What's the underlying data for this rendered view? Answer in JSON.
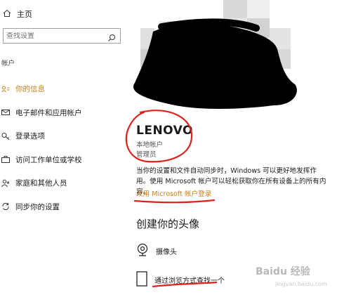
{
  "sidebar": {
    "home_label": "主页",
    "search_placeholder": "查找设置",
    "section_label": "帐户",
    "items": [
      {
        "label": "你的信息",
        "icon": "user-list-icon"
      },
      {
        "label": "电子邮件和应用帐户",
        "icon": "mail-icon"
      },
      {
        "label": "登录选项",
        "icon": "key-icon"
      },
      {
        "label": "访问工作单位或学校",
        "icon": "briefcase-icon"
      },
      {
        "label": "家庭和其他人员",
        "icon": "person-add-icon"
      },
      {
        "label": "同步你的设置",
        "icon": "sync-icon"
      }
    ]
  },
  "profile": {
    "name": "LENOVO",
    "account_type": "本地帐户",
    "role": "管理员"
  },
  "sync": {
    "text": "当你的设置和文件自动同步时，Windows 可以更好地发挥作用。使用 Microsoft 帐户可以轻松获取你在所有设备上的所有内容。",
    "link": "改用 Microsoft 帐户登录"
  },
  "picture": {
    "heading": "创建你的头像",
    "options": [
      {
        "label": "摄像头",
        "icon": "camera-icon"
      },
      {
        "label": "通过浏览方式查找一个",
        "icon": "browse-icon"
      }
    ]
  },
  "watermark": {
    "text": "Baidu 经验",
    "sub": "jingyan.baidu.com"
  },
  "colors": {
    "accent": "#c9801b",
    "annotation": "#e0201c",
    "redaction": "#000000"
  }
}
